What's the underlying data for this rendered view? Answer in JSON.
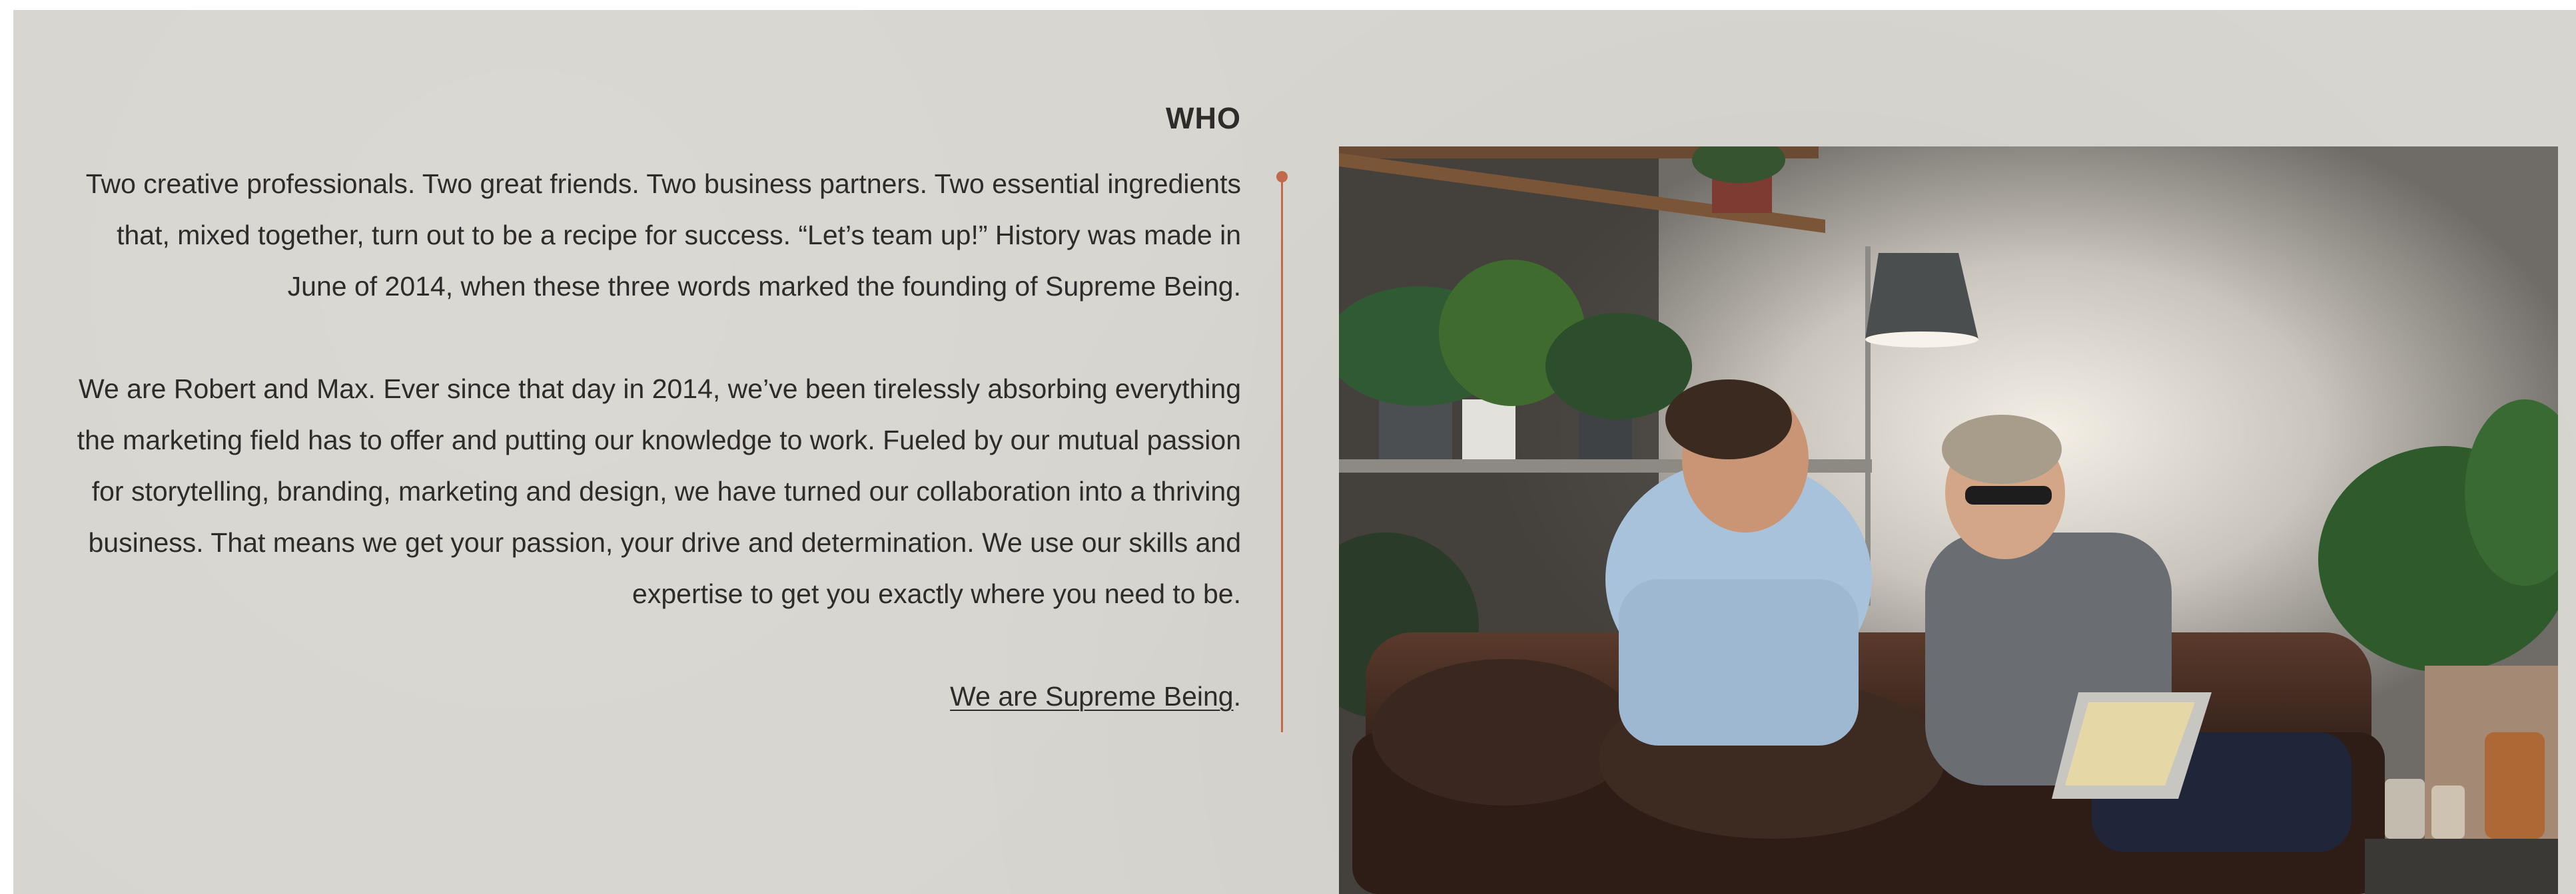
{
  "who": {
    "heading": "WHO",
    "paragraph_1": "Two creative professionals. Two great friends. Two business partners. Two essential ingredients that, mixed together, turn out to be a recipe for success. “Let’s team up!” History was made in June of 2014, when these three words marked the founding of Supreme Being.",
    "paragraph_2": "We are Robert and Max. Ever since that day in 2014, we’ve been tirelessly absorbing everything the marketing field has to offer and putting our knowledge to work. Fueled by our mutual passion for storytelling, branding, marketing and design, we have turned our collaboration into a thriving business. That means we get your passion, your drive and determination. We use our skills and expertise to get you exactly where you need to be.",
    "link_text": "We are Supreme Being",
    "link_suffix": "."
  },
  "colors": {
    "background": "#d7d5cf",
    "text": "#2f2b2b",
    "accent": "#c1694a"
  },
  "photo": {
    "subject": "two-men-laughing-on-leather-sofa-with-laptop"
  }
}
